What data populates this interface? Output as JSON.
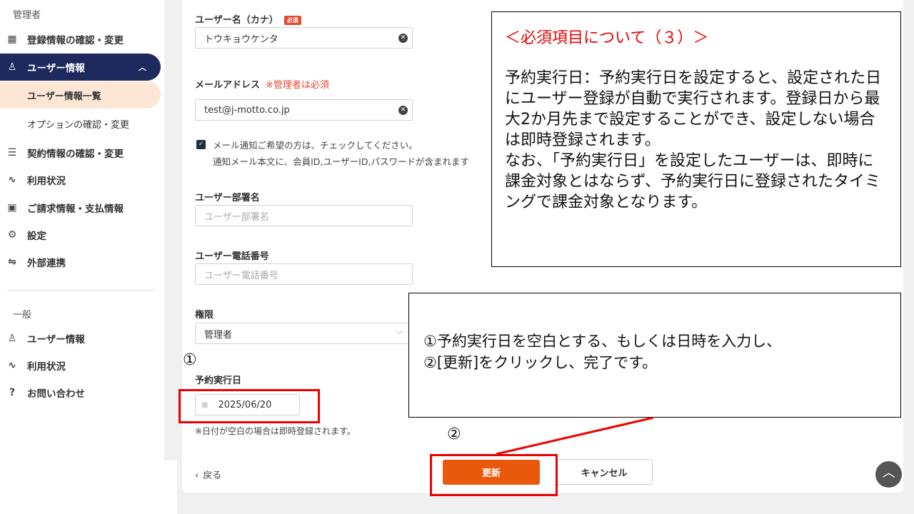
{
  "sidebar": {
    "admin_section": "管理者",
    "items": [
      {
        "label": "登録情報の確認・変更",
        "icon": "building-icon"
      },
      {
        "label": "ユーザー情報",
        "icon": "user-icon"
      },
      {
        "label": "ユーザー情報一覧"
      },
      {
        "label": "オプションの確認・変更"
      },
      {
        "label": "契約情報の確認・変更",
        "icon": "document-icon"
      },
      {
        "label": "利用状況",
        "icon": "activity-icon"
      },
      {
        "label": "ご請求情報・支払情報",
        "icon": "invoice-icon"
      },
      {
        "label": "設定",
        "icon": "gear-icon"
      },
      {
        "label": "外部連携",
        "icon": "integration-icon"
      }
    ],
    "general_section": "一般",
    "general_items": [
      {
        "label": "ユーザー情報",
        "icon": "user-icon"
      },
      {
        "label": "利用状況",
        "icon": "activity-icon"
      },
      {
        "label": "お問い合わせ",
        "icon": "help-icon"
      }
    ]
  },
  "form": {
    "kana_label": "ユーザー名（カナ）",
    "required_badge": "必須",
    "kana_value": "トウキョウケンタ",
    "email_label": "メールアドレス",
    "email_note": "※管理者は必須",
    "email_value": "test@j-motto.co.jp",
    "notify_checked": true,
    "notify_line1": "メール通知ご希望の方は、チェックしてください。",
    "notify_line2": "通知メール本文に、会員ID,ユーザーID,パスワードが含まれます",
    "dept_label": "ユーザー部署名",
    "dept_placeholder": "ユーザー部署名",
    "phone_label": "ユーザー電話番号",
    "phone_placeholder": "ユーザー電話番号",
    "role_label": "権限",
    "role_value": "管理者",
    "date_label": "予約実行日",
    "date_value": "2025/06/20",
    "date_note": "※日付が空白の場合は即時登録されます。",
    "back": "戻る",
    "update": "更新",
    "cancel": "キャンセル"
  },
  "annotations": {
    "title": "＜必須項目について（３）＞",
    "body1": "予約実行日：予約実行日を設定すると、設定された日にユーザー登録が自動で実行されます。登録日から最大2か月先まで設定することができ、設定しない場合は即時登録されます。",
    "body2": "なお、「予約実行日」を設定したユーザーは、即時に課金対象とはならず、予約実行日に登録されたタイミングで課金対象となります。",
    "step1": "①予約実行日を空白とする、もしくは日時を入力し、",
    "step2": "②[更新]をクリックし、完了です。",
    "marker1": "①",
    "marker2": "②",
    "highlight_color": "#ee0000"
  },
  "colors": {
    "primary_nav": "#1e2a5e",
    "update_button": "#e8590c",
    "selected_sub": "#fde6d3"
  }
}
